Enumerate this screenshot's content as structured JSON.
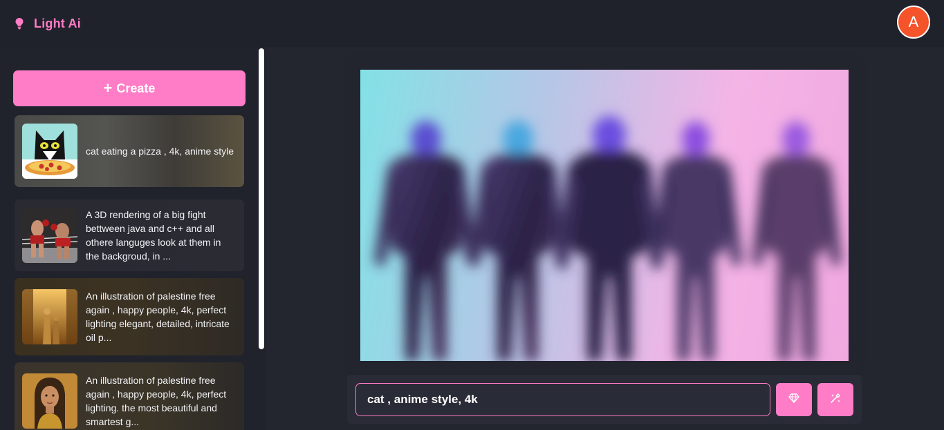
{
  "app": {
    "name": "Light Ai",
    "brand_color": "#ff7cc6"
  },
  "user": {
    "avatar_initial": "A",
    "avatar_color": "#f5532a"
  },
  "sidebar": {
    "create_label": "Create",
    "items": [
      {
        "caption": "cat eating a pizza , 4k, anime style",
        "thumb_icon": "cat-pizza-thumbnail"
      },
      {
        "caption": "A 3D rendering of a big fight bettween java and c++ and all othere languges look at them in the backgroud, in ...",
        "thumb_icon": "boxing-thumbnail"
      },
      {
        "caption": "An illustration of palestine free again , happy people, 4k, perfect lighting elegant, detailed, intricate oil p...",
        "thumb_icon": "golden-street-thumbnail"
      },
      {
        "caption": "An illustration of palestine free again , happy people, 4k, perfect lighting. the most beautiful and smartest g...",
        "thumb_icon": "portrait-thumbnail"
      }
    ]
  },
  "main": {
    "image_icon": "blurred-robots-image",
    "prompt_value": "cat , anime style, 4k"
  }
}
